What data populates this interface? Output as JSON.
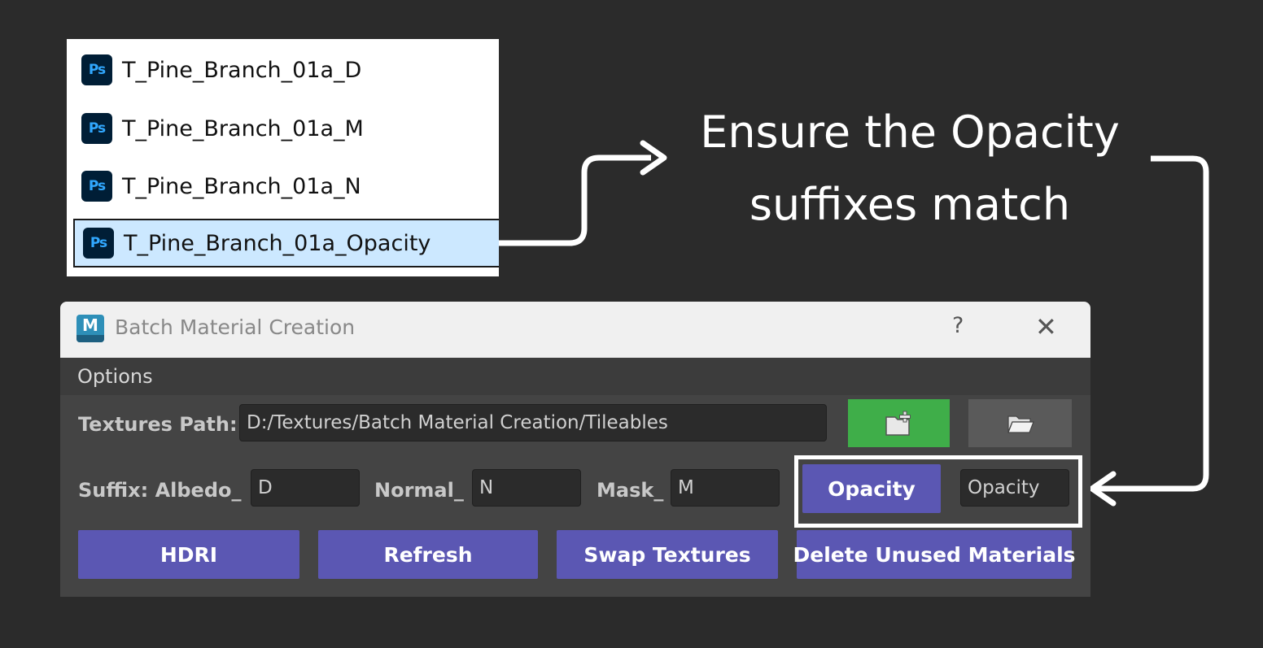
{
  "file_list": {
    "items": [
      {
        "icon": "Ps",
        "name": "T_Pine_Branch_01a_D"
      },
      {
        "icon": "Ps",
        "name": "T_Pine_Branch_01a_M"
      },
      {
        "icon": "Ps",
        "name": "T_Pine_Branch_01a_N"
      },
      {
        "icon": "Ps",
        "name": "T_Pine_Branch_01a_Opacity",
        "selected": true
      }
    ]
  },
  "annotation": {
    "text": "Ensure the Opacity\nsuffixes match"
  },
  "dialog": {
    "app_icon": "M",
    "title": "Batch Material Creation",
    "help_label": "?",
    "close_label": "✕",
    "menu": {
      "options": "Options"
    },
    "textures_path": {
      "label": "Textures Path:",
      "value": "D:/Textures/Batch Material Creation/Tileables"
    },
    "suffix": {
      "label": "Suffix: Albedo_",
      "albedo_value": "D",
      "normal_label": "Normal_",
      "normal_value": "N",
      "mask_label": "Mask_",
      "mask_value": "M",
      "opacity_button": "Opacity",
      "opacity_value": "Opacity"
    },
    "buttons": {
      "hdri": "HDRI",
      "refresh": "Refresh",
      "swap": "Swap Textures",
      "delete_unused": "Delete Unused Materials"
    },
    "colors": {
      "accent_button": "#5b57b3",
      "new_folder_button": "#3fae49",
      "browse_button": "#5a5a5a"
    }
  }
}
